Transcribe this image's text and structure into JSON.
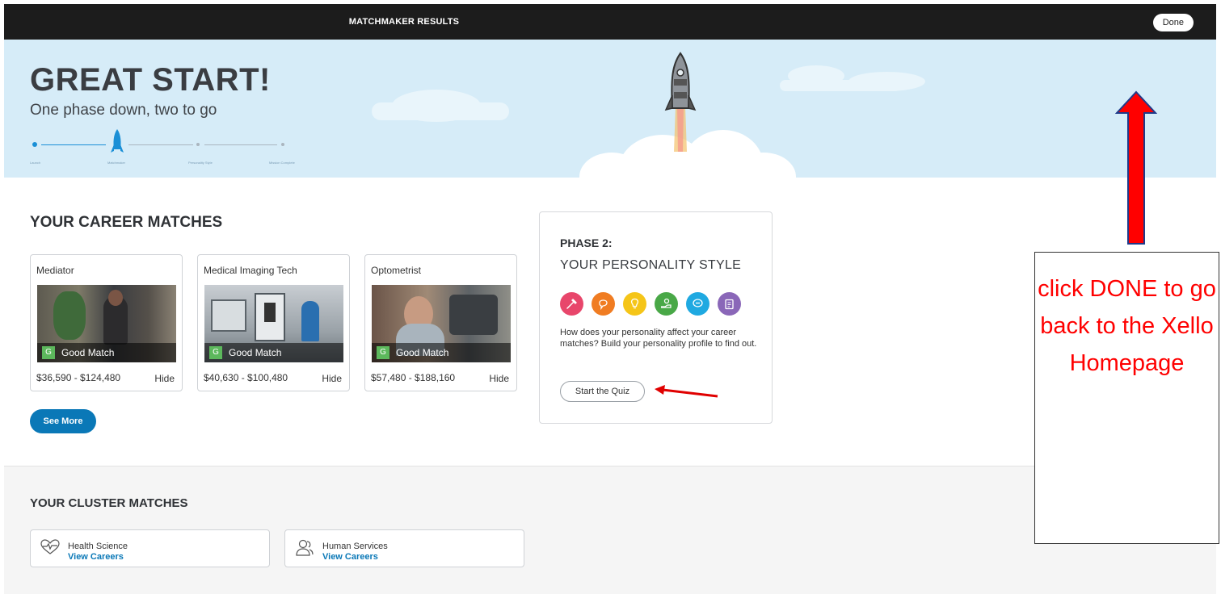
{
  "topbar": {
    "title": "MATCHMAKER RESULTS",
    "done_label": "Done"
  },
  "hero": {
    "title": "GREAT START!",
    "subtitle": "One phase down, two to go",
    "steps": [
      "Launch",
      "Matchmaker",
      "Personality Style",
      "Mission Complete"
    ]
  },
  "career": {
    "title": "YOUR CAREER MATCHES",
    "cards": [
      {
        "name": "Mediator",
        "badge": "G",
        "match": "Good Match",
        "salary": "$36,590 - $124,480",
        "hide": "Hide"
      },
      {
        "name": "Medical Imaging Tech",
        "badge": "G",
        "match": "Good Match",
        "salary": "$40,630 - $100,480",
        "hide": "Hide"
      },
      {
        "name": "Optometrist",
        "badge": "G",
        "match": "Good Match",
        "salary": "$57,480 - $188,160",
        "hide": "Hide"
      }
    ],
    "see_more": "See More"
  },
  "phase2": {
    "title": "PHASE 2:",
    "subtitle": "YOUR PERSONALITY STYLE",
    "icon_colors": [
      "#e8466b",
      "#f07c22",
      "#f5c518",
      "#49a847",
      "#1fa9e1",
      "#8a67b8"
    ],
    "description": "How does your personality affect your career matches? Build your personality profile to find out.",
    "quiz_button": "Start the Quiz"
  },
  "cluster": {
    "title": "YOUR CLUSTER MATCHES",
    "items": [
      {
        "name": "Health Science",
        "link": "View Careers",
        "icon": "heart-pulse-icon"
      },
      {
        "name": "Human Services",
        "link": "View Careers",
        "icon": "people-icon"
      }
    ]
  },
  "annotation": {
    "text": "click DONE to go back to the Xello Homepage",
    "color": "#ff0000"
  }
}
